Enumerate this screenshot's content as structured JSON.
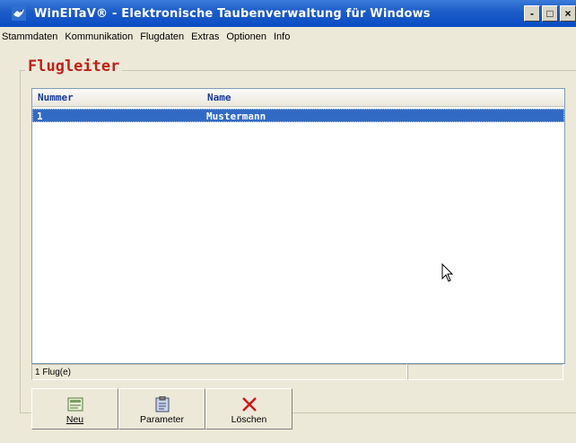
{
  "window": {
    "title": "WinElTaV® - Elektronische Taubenverwaltung für Windows",
    "buttons": [
      "-",
      "□",
      "×"
    ]
  },
  "menu": {
    "items": [
      "Stammdaten",
      "Kommunikation",
      "Flugdaten",
      "Extras",
      "Optionen",
      "Info"
    ]
  },
  "panel": {
    "title": "Flugleiter",
    "title_color": "#c0201a"
  },
  "list": {
    "columns": [
      "Nummer",
      "Name"
    ],
    "rows": [
      {
        "nummer": "1",
        "name": "Mustermann",
        "selected": true
      }
    ],
    "selection_color": "#316ac5"
  },
  "status": {
    "left": "1 Flug(e)",
    "right": ""
  },
  "toolbar": {
    "new_label": "Neu",
    "params_label": "Parameter",
    "delete_label": "Löschen"
  },
  "icons": {
    "app": "pigeon-icon",
    "new": "new-document-icon",
    "params": "clipboard-icon",
    "delete": "delete-x-icon"
  }
}
